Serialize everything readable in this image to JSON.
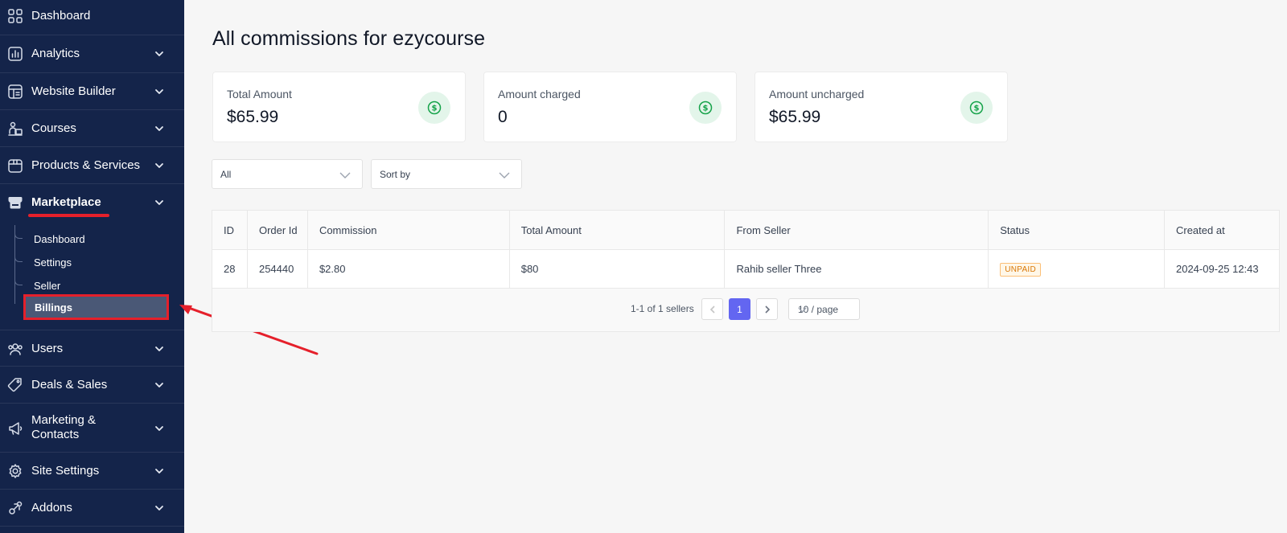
{
  "sidebar": {
    "items": [
      {
        "label": "Dashboard",
        "icon": "dashboard-grid-icon"
      },
      {
        "label": "Analytics",
        "icon": "analytics-chart-icon"
      },
      {
        "label": "Website Builder",
        "icon": "website-builder-icon"
      },
      {
        "label": "Courses",
        "icon": "courses-icon"
      },
      {
        "label": "Products & Services",
        "icon": "box-icon"
      },
      {
        "label": "Marketplace",
        "icon": "store-icon"
      },
      {
        "label": "Users",
        "icon": "users-icon"
      },
      {
        "label": "Deals & Sales",
        "icon": "tag-icon"
      },
      {
        "label": "Marketing &\nContacts",
        "icon": "megaphone-icon"
      },
      {
        "label": "Site Settings",
        "icon": "settings-gear-icon"
      },
      {
        "label": "Addons",
        "icon": "addons-icon"
      }
    ],
    "marketplace_sub": [
      "Dashboard",
      "Settings",
      "Seller",
      "Billings"
    ]
  },
  "main": {
    "title": "All commissions for ezycourse",
    "cards": [
      {
        "label": "Total Amount",
        "value": "$65.99"
      },
      {
        "label": "Amount charged",
        "value": "0"
      },
      {
        "label": "Amount uncharged",
        "value": "$65.99"
      }
    ],
    "filters": {
      "status": "All",
      "sort": "Sort by"
    },
    "table": {
      "columns": [
        "ID",
        "Order Id",
        "Commission",
        "Total Amount",
        "From Seller",
        "Status",
        "Created at"
      ],
      "rows": [
        {
          "id": "28",
          "order_id": "254440",
          "commission": "$2.80",
          "total": "$80",
          "seller": "Rahib seller Three",
          "status": "UNPAID",
          "created": "2024-09-25 12:43"
        }
      ]
    },
    "pagination": {
      "summary": "1-1 of 1 sellers",
      "current": "1",
      "page_size": "10 / page"
    }
  },
  "colors": {
    "sidebar_bg": "#14244a",
    "accent": "#6366f1",
    "annotation_red": "#e5202b",
    "success_icon": "#16a34a",
    "unpaid": "#d97706"
  }
}
